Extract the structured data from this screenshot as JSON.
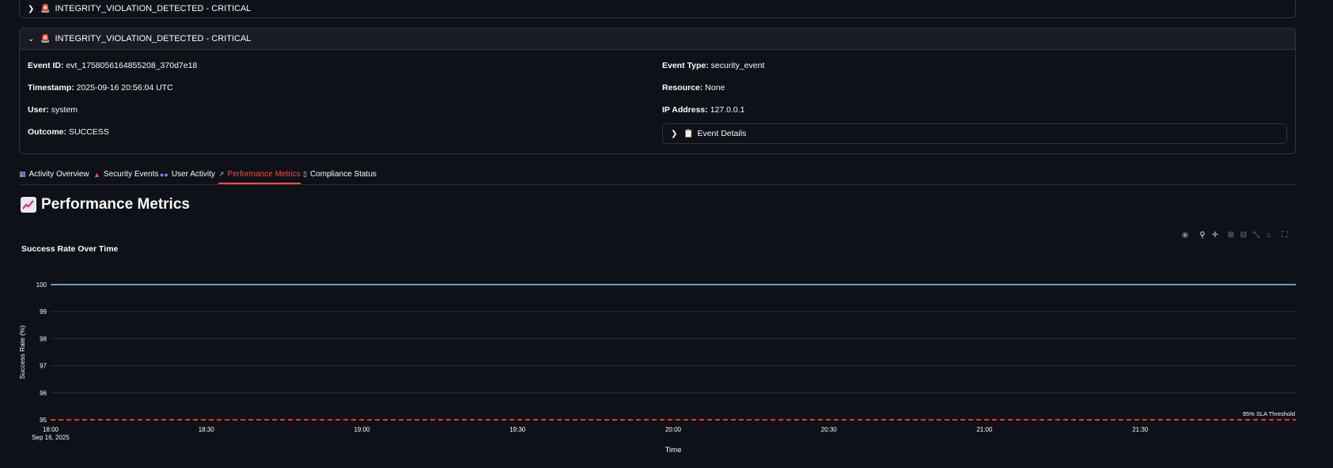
{
  "events": [
    {
      "title": "INTEGRITY_VIOLATION_DETECTED - CRITICAL",
      "expanded": false
    },
    {
      "title": "INTEGRITY_VIOLATION_DETECTED - CRITICAL",
      "expanded": true,
      "fields": {
        "event_id_label": "Event ID:",
        "event_id": "evt_1758056164855208_370d7e18",
        "timestamp_label": "Timestamp:",
        "timestamp": "2025-09-16 20:56:04 UTC",
        "user_label": "User:",
        "user": "system",
        "outcome_label": "Outcome:",
        "outcome": "SUCCESS",
        "event_type_label": "Event Type:",
        "event_type": "security_event",
        "resource_label": "Resource:",
        "resource": "None",
        "ip_label": "IP Address:",
        "ip": "127.0.0.1"
      },
      "details_label": "Event Details"
    }
  ],
  "tabs": [
    {
      "label": "Activity Overview",
      "icon": "bar-chart-icon",
      "active": false
    },
    {
      "label": "Security Events",
      "icon": "alarm-icon",
      "active": false
    },
    {
      "label": "User Activity",
      "icon": "users-icon",
      "active": false
    },
    {
      "label": "Performance Metrics",
      "icon": "trend-chart-icon",
      "active": true
    },
    {
      "label": "Compliance Status",
      "icon": "clipboard-icon",
      "active": false
    }
  ],
  "page_title": "Performance Metrics",
  "accent_color": "#ff4b4b",
  "modebar": [
    "camera-icon",
    "zoom-icon",
    "pan-icon",
    "zoom-in-icon",
    "zoom-out-icon",
    "autoscale-icon",
    "home-icon",
    "fullscreen-icon"
  ],
  "chart_data": {
    "type": "line",
    "title": "Success Rate Over Time",
    "xlabel": "Time",
    "ylabel": "Success Rate (%)",
    "ylim": [
      95,
      100
    ],
    "yticks": [
      "95",
      "96",
      "97",
      "98",
      "99",
      "100"
    ],
    "xticks": [
      "18:00",
      "18:30",
      "19:00",
      "19:30",
      "20:00",
      "20:30",
      "21:00",
      "21:30"
    ],
    "xtick_sub": "Sep 16, 2025",
    "series": [
      {
        "x": [
          "2025-09-16 18:00",
          "2025-09-16 22:00"
        ],
        "values": [
          100,
          100
        ],
        "color": "#83c9ff"
      }
    ],
    "threshold": {
      "value": 95,
      "label": "95% SLA Threshold",
      "color": "#ff2b2b"
    }
  }
}
